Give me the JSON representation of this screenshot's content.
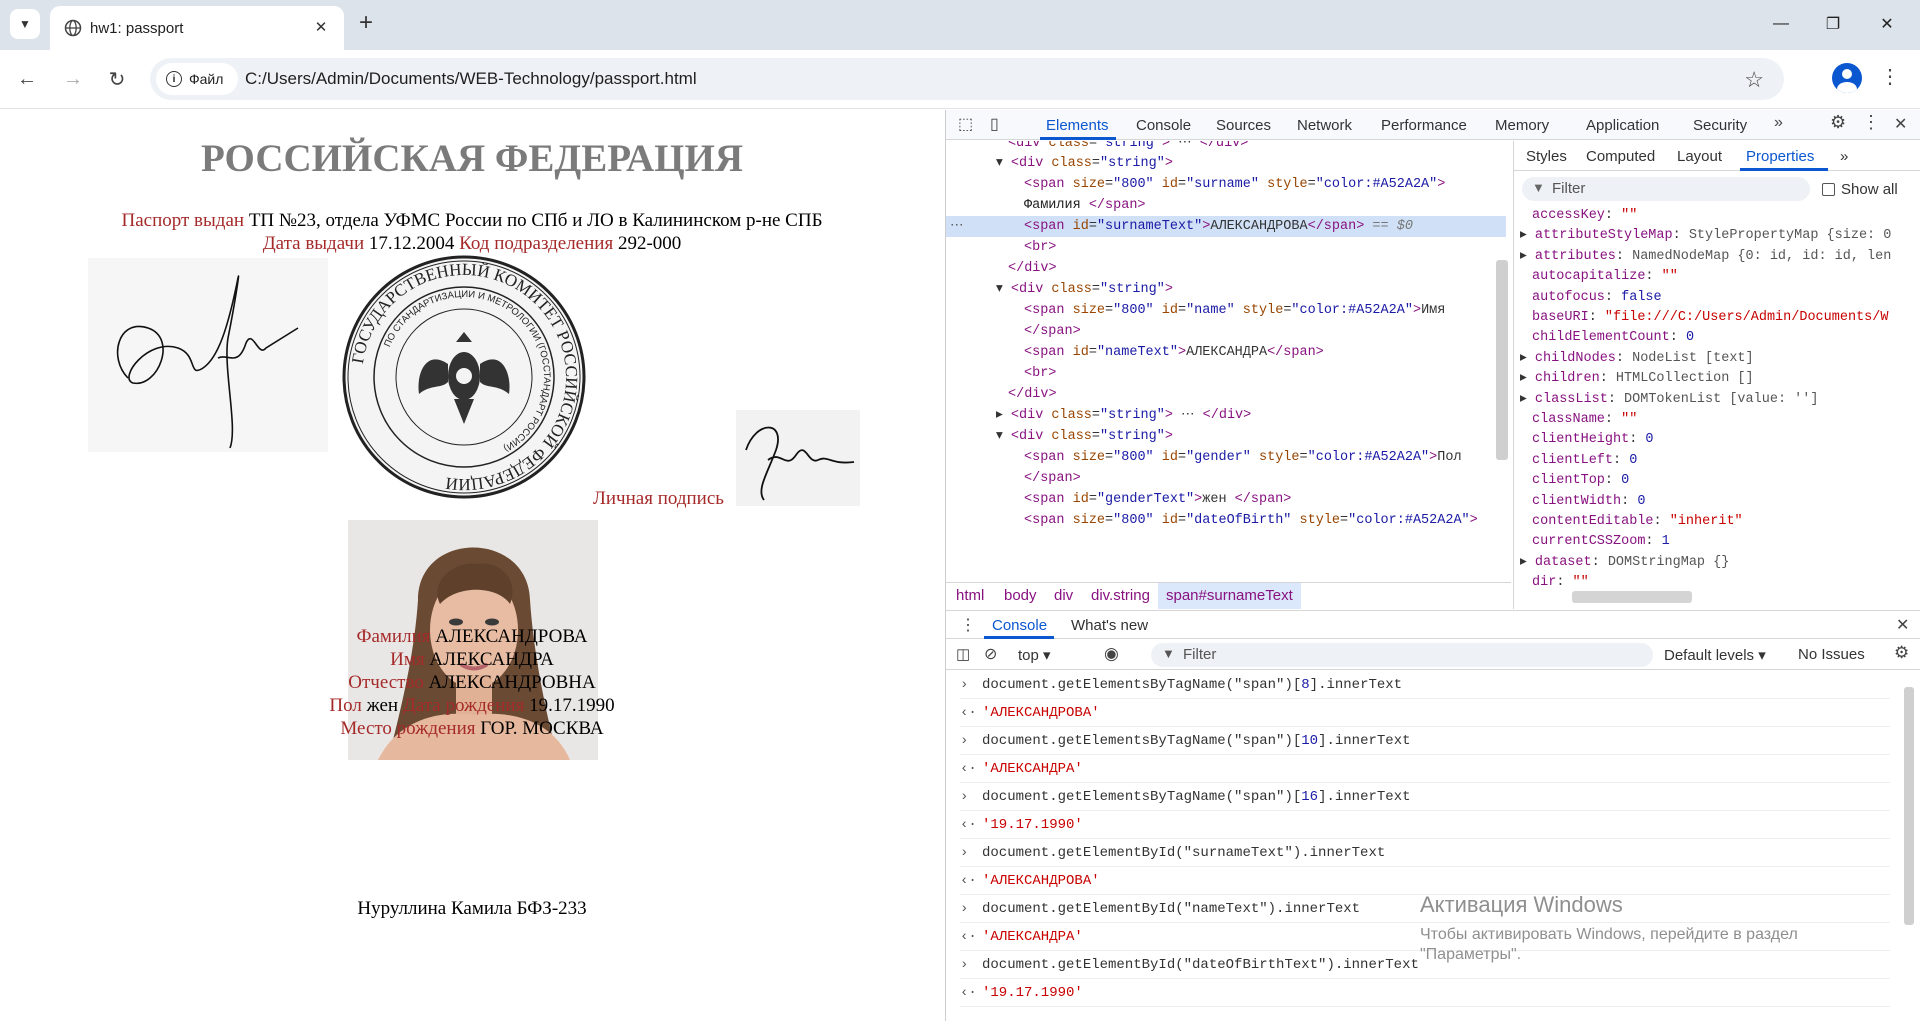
{
  "browser": {
    "tab_title": "hw1: passport",
    "address_chip": "Файл",
    "url": "C:/Users/Admin/Documents/WEB-Technology/passport.html"
  },
  "passport": {
    "heading": "РОССИЙСКАЯ ФЕДЕРАЦИЯ",
    "issued_label": "Паспорт выдан",
    "issued_value": "ТП №23, отдела УФМС России по СПб и ЛО в Калининском р-не СПБ",
    "date_label": "Дата выдачи",
    "date_value": "17.12.2004",
    "code_label": "Код подразделения",
    "code_value": "292-000",
    "signature_label": "Личная подпись",
    "seal_outer_text": "ГОСУДАРСТВЕННЫЙ КОМИТЕТ РОССИЙСКОЙ ФЕДЕРАЦИИ",
    "seal_inner_text": "ПО СТАНДАРТИЗАЦИИ И МЕТРОЛОГИИ (ГОССТАНДАРТ РОССИИ)",
    "surname_label": "Фамилия",
    "surname_value": "АЛЕКСАНДРОВА",
    "name_label": "Имя",
    "name_value": "АЛЕКСАНДРА",
    "patronymic_label": "Отчество",
    "patronymic_value": "АЛЕКСАНДРОВНА",
    "gender_label": "Пол",
    "gender_value": "жен",
    "birth_label": "Дата рождения",
    "birth_value": "19.17.1990",
    "birthplace_label": "Место рождения",
    "birthplace_value": "ГОР. МОСКВА",
    "author": "Нуруллина Камила БФЗ-233"
  },
  "devtools": {
    "tabs": [
      "Elements",
      "Console",
      "Sources",
      "Network",
      "Performance",
      "Memory",
      "Application",
      "Security"
    ],
    "breadcrumbs": [
      "html",
      "body",
      "div",
      "div.string"
    ],
    "breadcrumb_selected": "span#surnameText",
    "side_tabs": [
      "Styles",
      "Computed",
      "Layout",
      "Properties"
    ],
    "props_filter_placeholder": "Filter",
    "show_all": "Show all",
    "properties": [
      {
        "key": "accessKey",
        "value": "\"\"",
        "kind": "s",
        "exp": false
      },
      {
        "key": "attributeStyleMap",
        "value": "StylePropertyMap {size: 0",
        "kind": "t",
        "exp": true
      },
      {
        "key": "attributes",
        "value": "NamedNodeMap {0: id, id: id, len",
        "kind": "t",
        "exp": true
      },
      {
        "key": "autocapitalize",
        "value": "\"\"",
        "kind": "s",
        "exp": false
      },
      {
        "key": "autofocus",
        "value": "false",
        "kind": "n",
        "exp": false
      },
      {
        "key": "baseURI",
        "value": "\"file:///C:/Users/Admin/Documents/W",
        "kind": "s",
        "exp": false
      },
      {
        "key": "childElementCount",
        "value": "0",
        "kind": "n",
        "exp": false
      },
      {
        "key": "childNodes",
        "value": "NodeList [text]",
        "kind": "t",
        "exp": true
      },
      {
        "key": "children",
        "value": "HTMLCollection []",
        "kind": "t",
        "exp": true
      },
      {
        "key": "classList",
        "value": "DOMTokenList [value: '']",
        "kind": "t",
        "exp": true
      },
      {
        "key": "className",
        "value": "\"\"",
        "kind": "s",
        "exp": false
      },
      {
        "key": "clientHeight",
        "value": "0",
        "kind": "n",
        "exp": false
      },
      {
        "key": "clientLeft",
        "value": "0",
        "kind": "n",
        "exp": false
      },
      {
        "key": "clientTop",
        "value": "0",
        "kind": "n",
        "exp": false
      },
      {
        "key": "clientWidth",
        "value": "0",
        "kind": "n",
        "exp": false
      },
      {
        "key": "contentEditable",
        "value": "\"inherit\"",
        "kind": "s",
        "exp": false
      },
      {
        "key": "currentCSSZoom",
        "value": "1",
        "kind": "n",
        "exp": false
      },
      {
        "key": "dataset",
        "value": "DOMStringMap {}",
        "kind": "t",
        "exp": true
      },
      {
        "key": "dir",
        "value": "\"\"",
        "kind": "s",
        "exp": false
      }
    ],
    "console_tabs": [
      "Console",
      "What's new"
    ],
    "context": "top",
    "console_filter_placeholder": "Filter",
    "levels": "Default levels",
    "issues": "No Issues",
    "console_lines": [
      {
        "type": "in",
        "text": "document.getElementsByTagName(\"span\")[8].innerText"
      },
      {
        "type": "out",
        "text": "'АЛЕКСАНДРОВА'"
      },
      {
        "type": "in",
        "text": "document.getElementsByTagName(\"span\")[10].innerText"
      },
      {
        "type": "out",
        "text": "'АЛЕКСАНДРА'"
      },
      {
        "type": "in",
        "text": "document.getElementsByTagName(\"span\")[16].innerText"
      },
      {
        "type": "out",
        "text": "'19.17.1990'"
      },
      {
        "type": "in",
        "text": "document.getElementById(\"surnameText\").innerText"
      },
      {
        "type": "out",
        "text": "'АЛЕКСАНДРОВА'"
      },
      {
        "type": "in",
        "text": "document.getElementById(\"nameText\").innerText"
      },
      {
        "type": "out",
        "text": "'АЛЕКСАНДРА'"
      },
      {
        "type": "in",
        "text": "document.getElementById(\"dateOfBirthText\").innerText"
      },
      {
        "type": "out",
        "text": "'19.17.1990'"
      }
    ]
  },
  "windows_activation": {
    "title": "Активация Windows",
    "line1": "Чтобы активировать Windows, перейдите в раздел",
    "line2": "\"Параметры\"."
  },
  "colors": {
    "label_red": "#a52a2a",
    "heading_gray": "#7b7b7b",
    "accent_blue": "#0b57d0"
  }
}
